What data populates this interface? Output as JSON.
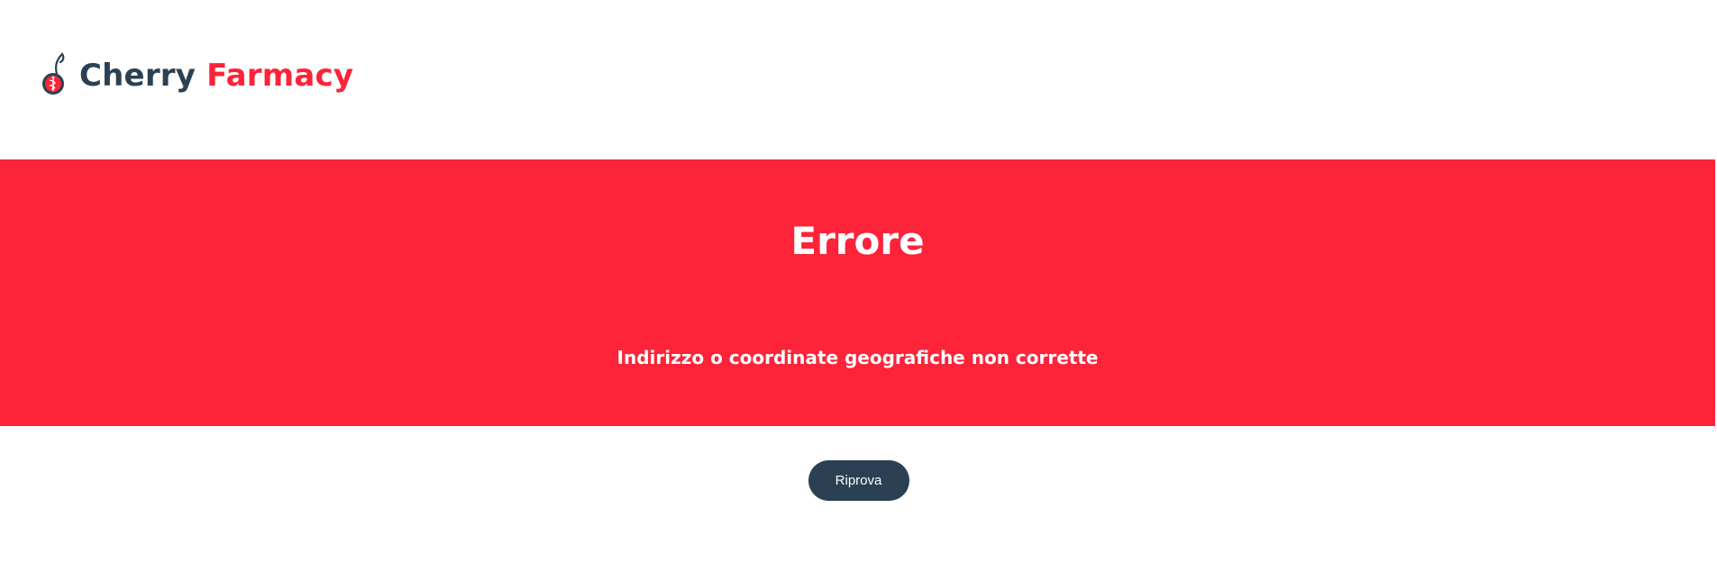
{
  "header": {
    "logo": {
      "icon": "cherry-caduceus-icon",
      "word_1": "Cherry",
      "word_2": "Farmacy"
    }
  },
  "error": {
    "title": "Errore",
    "message": "Indirizzo o coordinate geografiche non corrette"
  },
  "actions": {
    "retry_label": "Riprova"
  },
  "colors": {
    "brand_red": "#fd2339",
    "brand_navy": "#2b4153",
    "background": "#ffffff"
  }
}
